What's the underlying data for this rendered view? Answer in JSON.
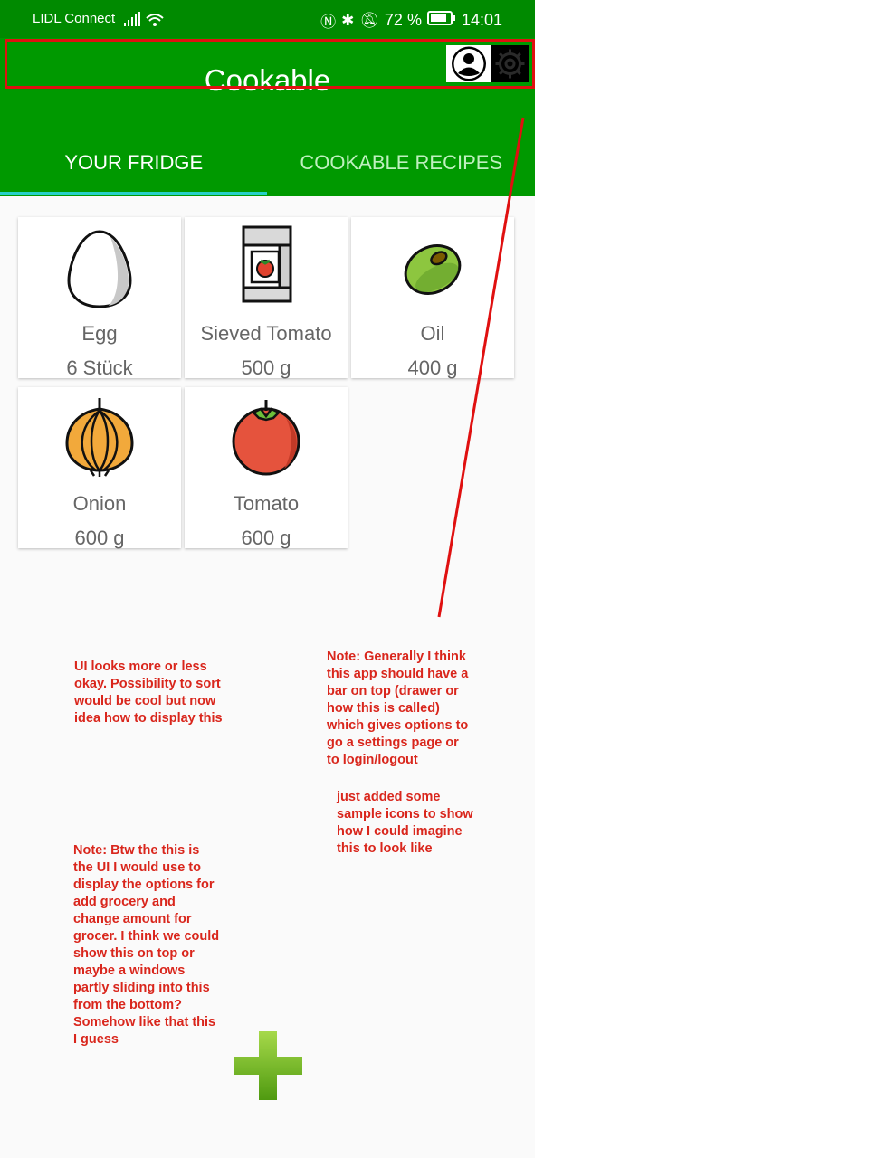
{
  "statusbar": {
    "carrier": "LIDL Connect",
    "battery_percent": "72 %",
    "time": "14:01"
  },
  "app": {
    "title": "Cookable",
    "tabs": [
      {
        "label": "YOUR FRIDGE",
        "active": true
      },
      {
        "label": "COOKABLE RECIPES",
        "active": false
      }
    ]
  },
  "fridge_items": [
    {
      "name": "Egg",
      "amount": "6 Stück",
      "icon": "egg-icon"
    },
    {
      "name": "Sieved Tomato",
      "amount": "500 g",
      "icon": "sieved-tomato-icon"
    },
    {
      "name": "Oil",
      "amount": "400 g",
      "icon": "olive-icon"
    },
    {
      "name": "Onion",
      "amount": "600 g",
      "icon": "onion-icon"
    },
    {
      "name": "Tomato",
      "amount": "600 g",
      "icon": "tomato-icon"
    }
  ],
  "notes": {
    "note1": "UI looks more or less okay. Possibility to sort would be cool but now idea how to display this",
    "note2": "Note: Generally I think this app should have a bar on top (drawer or how this is called) which gives options to go a settings page or to login/logout",
    "note3": "just added some sample icons to show how I could imagine this to look like",
    "note4": "Note: Btw the this is the UI I would use to display the options for add grocery and change amount for grocer. I think we could show this on top or maybe a windows partly sliding into this from the bottom? Somehow like that this I guess"
  },
  "colors": {
    "appbar": "#009900",
    "statusbar": "#008a00",
    "tab_indicator": "#26d0c8",
    "annotation": "#d9261c"
  }
}
